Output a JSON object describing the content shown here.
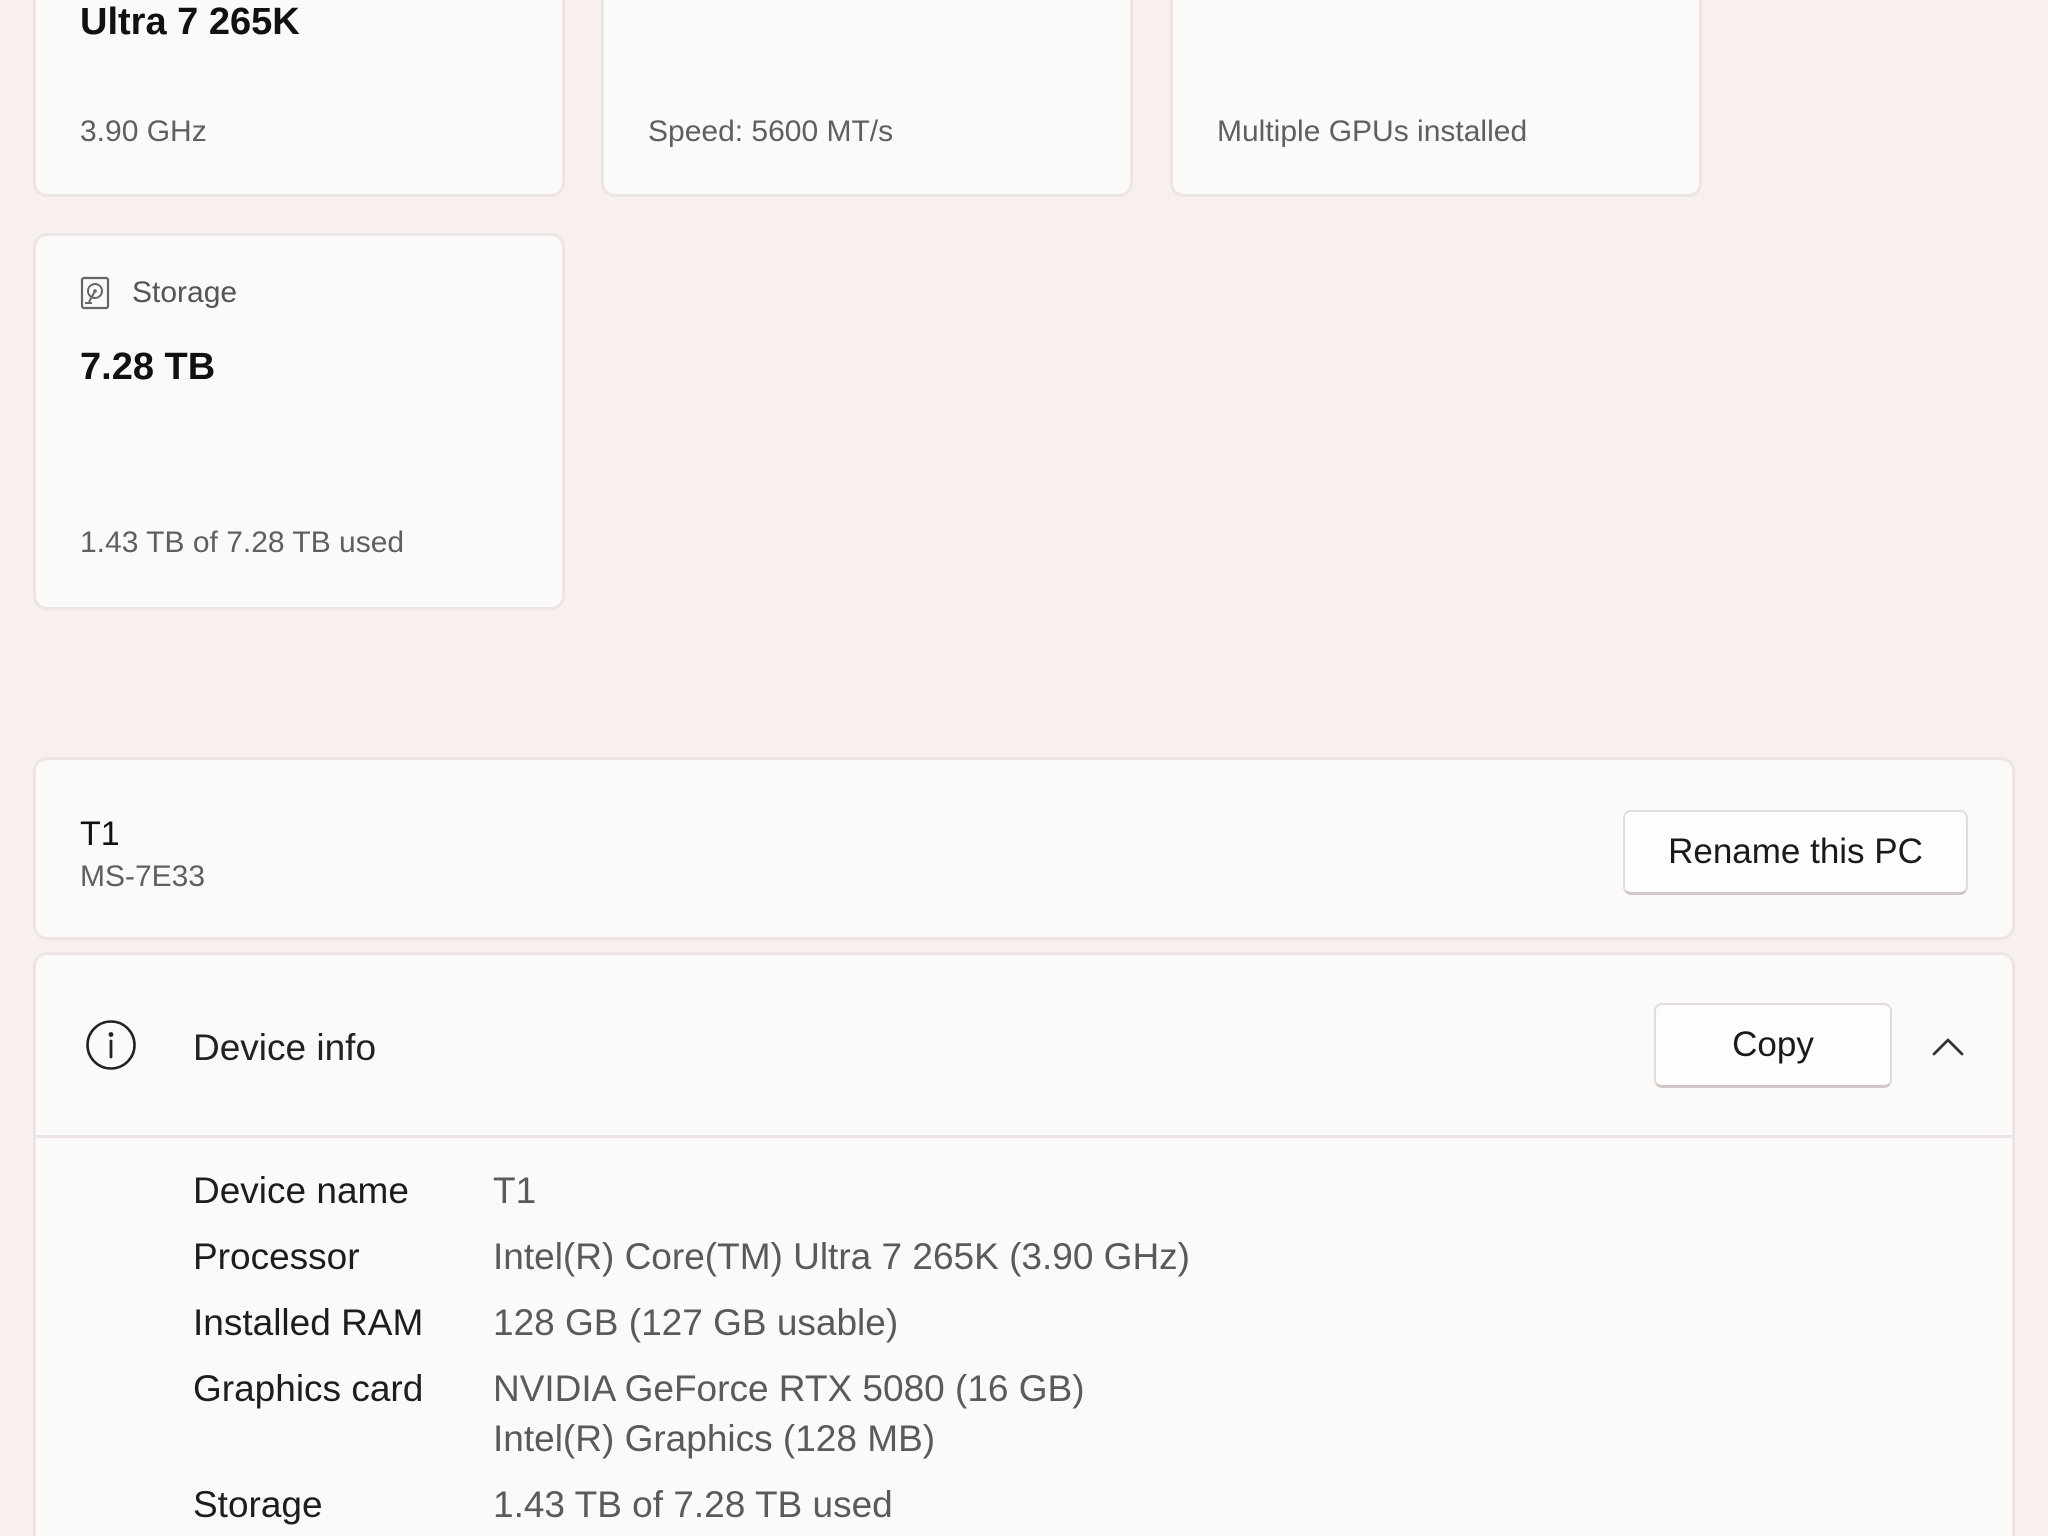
{
  "cards": {
    "cpu": {
      "value": "Ultra 7 265K",
      "sub": "3.90 GHz"
    },
    "ram": {
      "sub": "Speed: 5600 MT/s"
    },
    "gpu": {
      "sub": "Multiple GPUs installed"
    },
    "storage": {
      "title": "Storage",
      "value": "7.28 TB",
      "sub": "1.43 TB of 7.28 TB used",
      "icon": "hard-drive-icon"
    }
  },
  "pc": {
    "name": "T1",
    "model": "MS-7E33",
    "rename_label": "Rename this PC"
  },
  "device_info": {
    "title": "Device info",
    "copy_label": "Copy",
    "icon": "info-icon",
    "rows": [
      {
        "label": "Device name",
        "value": "T1"
      },
      {
        "label": "Processor",
        "value": "Intel(R) Core(TM) Ultra 7 265K (3.90 GHz)"
      },
      {
        "label": "Installed RAM",
        "value": "128 GB (127 GB usable)"
      },
      {
        "label": "Graphics card",
        "value": "NVIDIA GeForce RTX 5080 (16 GB)",
        "value2": "Intel(R) Graphics (128 MB)"
      },
      {
        "label": "Storage",
        "value": "1.43 TB of 7.28 TB used"
      }
    ]
  }
}
